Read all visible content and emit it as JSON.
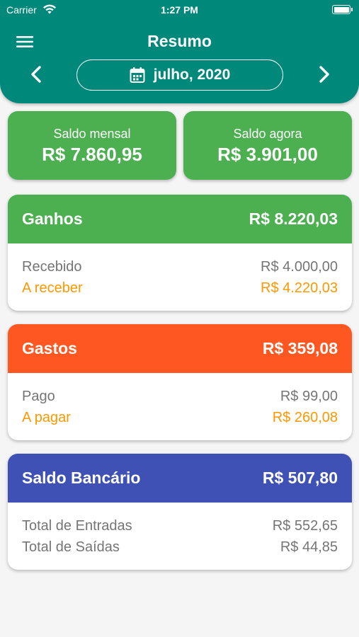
{
  "status_bar": {
    "carrier": "Carrier",
    "time": "1:27 PM"
  },
  "header": {
    "title": "Resumo",
    "month": "julho, 2020",
    "icons": {
      "menu": "menu-icon",
      "prev": "chevron-left-icon",
      "next": "chevron-right-icon",
      "calendar": "calendar-icon"
    }
  },
  "balances": {
    "monthly": {
      "label": "Saldo mensal",
      "value": "R$ 7.860,95"
    },
    "now": {
      "label": "Saldo agora",
      "value": "R$ 3.901,00"
    }
  },
  "ganhos": {
    "title": "Ganhos",
    "total": "R$ 8.220,03",
    "rows": [
      {
        "label": "Recebido",
        "value": "R$ 4.000,00"
      },
      {
        "label": "A receber",
        "value": "R$ 4.220,03"
      }
    ]
  },
  "gastos": {
    "title": "Gastos",
    "total": "R$ 359,08",
    "rows": [
      {
        "label": "Pago",
        "value": "R$ 99,00"
      },
      {
        "label": "A pagar",
        "value": "R$ 260,08"
      }
    ]
  },
  "saldo_bancario": {
    "title": "Saldo Bancário",
    "total": "R$ 507,80",
    "rows": [
      {
        "label": "Total de Entradas",
        "value": "R$ 552,65"
      },
      {
        "label": "Total de Saídas",
        "value": "R$ 44,85"
      }
    ]
  },
  "colors": {
    "header": "#00897b",
    "balance_card": "#4caf50",
    "ganhos": "#4caf50",
    "gastos": "#ff5722",
    "saldo_bancario": "#3f51b5",
    "pending_text": "#ff9800"
  }
}
